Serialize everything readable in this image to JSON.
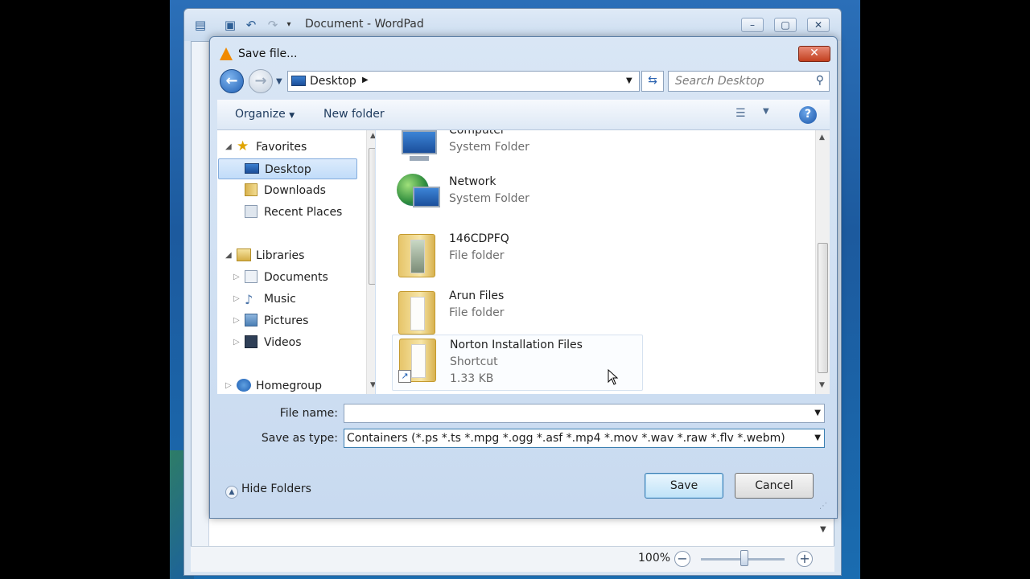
{
  "wordpad": {
    "title": "Document - WordPad",
    "zoom": "100%",
    "colors": {
      "frame": "#d7e4f2"
    }
  },
  "dialog": {
    "title": "Save file...",
    "close_glyph": "✕",
    "address": "Desktop",
    "search_placeholder": "Search Desktop",
    "toolbar": {
      "organize": "Organize",
      "new_folder": "New folder"
    },
    "nav": {
      "favorites": "Favorites",
      "desktop": "Desktop",
      "downloads": "Downloads",
      "recent_places": "Recent Places",
      "libraries": "Libraries",
      "documents": "Documents",
      "music": "Music",
      "pictures": "Pictures",
      "videos": "Videos",
      "homegroup": "Homegroup"
    },
    "files": [
      {
        "name": "Computer",
        "type": "System Folder",
        "icon": "computer-icon"
      },
      {
        "name": "Network",
        "type": "System Folder",
        "icon": "network-icon"
      },
      {
        "name": "146CDPFQ",
        "type": "File folder",
        "icon": "folder-icon"
      },
      {
        "name": "Arun Files",
        "type": "File folder",
        "icon": "folder-icon"
      },
      {
        "name": "Norton Installation Files",
        "type": "Shortcut",
        "size": "1.33 KB",
        "icon": "shortcut-folder-icon"
      }
    ],
    "file_name_label": "File name:",
    "file_name_value": "",
    "save_type_label": "Save as type:",
    "save_type_value": "Containers (*.ps *.ts *.mpg *.ogg *.asf *.mp4 *.mov *.wav *.raw *.flv *.webm)",
    "hide_folders": "Hide Folders",
    "save_button": "Save",
    "cancel_button": "Cancel"
  }
}
